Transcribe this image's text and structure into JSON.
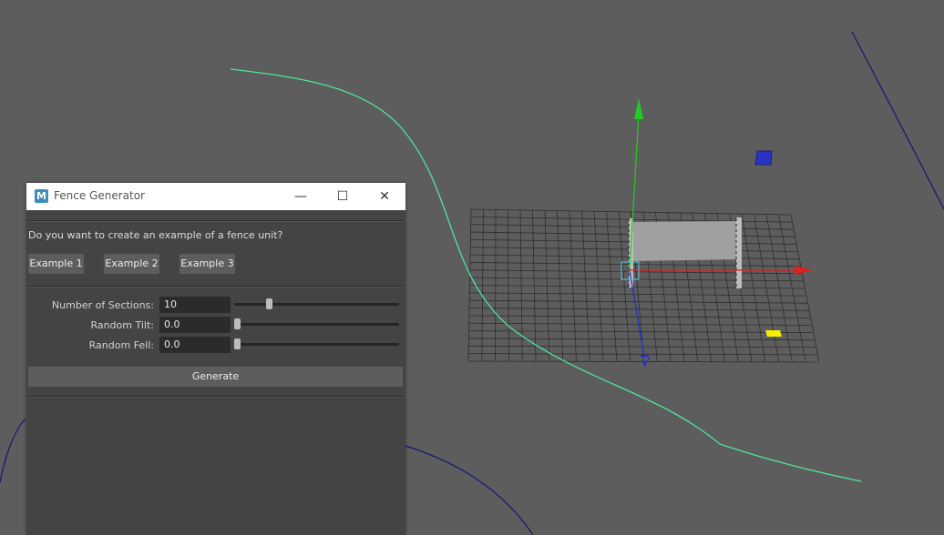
{
  "window": {
    "title": "Fence Generator",
    "app_icon": "M",
    "minimize_icon": "—",
    "maximize_icon": "☐",
    "close_icon": "✕"
  },
  "question": "Do you want to create an example of a fence unit?",
  "examples": [
    "Example 1",
    "Example 2",
    "Example 3"
  ],
  "fields": [
    {
      "label": "Number of Sections:",
      "value": "10",
      "slider_fraction": 0.2
    },
    {
      "label": "Random Tilt:",
      "value": "0.0",
      "slider_fraction": 0.0
    },
    {
      "label": "Random Fell:",
      "value": "0.0",
      "slider_fraction": 0.0
    }
  ],
  "generate_label": "Generate",
  "colors": {
    "viewport_bg": "#5d5d5d",
    "curve": "#4fe39c",
    "x_axis": "#e02020",
    "y_axis": "#22cc22",
    "z_axis": "#1a2fd6",
    "dark_curve": "#101873",
    "dialog_bg": "#444444"
  }
}
